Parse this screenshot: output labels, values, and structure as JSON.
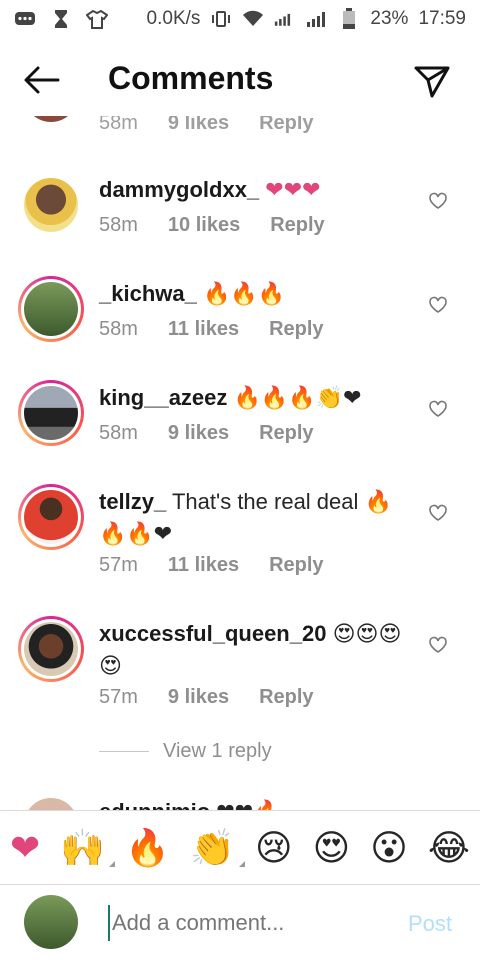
{
  "status": {
    "speed": "0.0K/s",
    "battery": "23%",
    "time": "17:59"
  },
  "header": {
    "title": "Comments"
  },
  "partial_top": {
    "time": "58m",
    "likes": "9 likes",
    "reply": "Reply"
  },
  "comments": [
    {
      "user": "dammygoldxx_",
      "text": "",
      "emojis": "❤❤❤",
      "time": "58m",
      "likes": "10 likes",
      "reply": "Reply"
    },
    {
      "user": "_kichwa_",
      "text": "",
      "emojis": "🔥🔥🔥",
      "time": "58m",
      "likes": "11 likes",
      "reply": "Reply"
    },
    {
      "user": "king__azeez",
      "text": "",
      "emojis": "🔥🔥🔥👏❤",
      "time": "58m",
      "likes": "9 likes",
      "reply": "Reply"
    },
    {
      "user": "tellzy_",
      "text": "That's the real deal",
      "emojis": "🔥🔥🔥❤",
      "time": "57m",
      "likes": "11 likes",
      "reply": "Reply"
    },
    {
      "user": "xuccessful_queen_20",
      "text": "",
      "emojis": "😍😍😍😍",
      "time": "57m",
      "likes": "9 likes",
      "reply": "Reply"
    }
  ],
  "view_reply": "View 1 reply",
  "partial_bottom": {
    "user": "edunnimio",
    "emojis": "❤❤🔥"
  },
  "emoji_bar": [
    "❤",
    "🙌",
    "🔥",
    "👏",
    "😢",
    "😍",
    "😮",
    "😂"
  ],
  "composer": {
    "placeholder": "Add a comment...",
    "post": "Post"
  }
}
